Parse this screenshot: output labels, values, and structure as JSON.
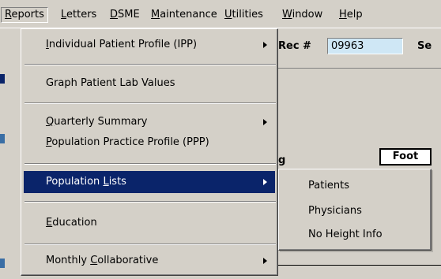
{
  "menubar": {
    "items": [
      {
        "label": "Reports",
        "active": true
      },
      {
        "label": "Letters"
      },
      {
        "label": "DSME"
      },
      {
        "label": "Maintenance"
      },
      {
        "label": "Utilities"
      },
      {
        "label": "Window"
      },
      {
        "label": "Help"
      }
    ]
  },
  "background": {
    "rec_label": "Rec #",
    "rec_value": "09963",
    "se_label": "Se",
    "foot_label": "Foot",
    "g_fragment": "g"
  },
  "reports_menu": {
    "items": [
      {
        "label_pre": "",
        "label_u": "I",
        "label_post": "ndividual Patient Profile (IPP)",
        "submenu": true
      },
      {
        "label_pre": "Graph Patient Lab Values",
        "label_u": "",
        "label_post": "",
        "submenu": false
      },
      {
        "label_pre": "",
        "label_u": "Q",
        "label_post": "uarterly Summary",
        "submenu": true
      },
      {
        "label_pre": "",
        "label_u": "P",
        "label_post": "opulation Practice Profile (PPP)",
        "submenu": false
      },
      {
        "label_pre": "Population ",
        "label_u": "L",
        "label_post": "ists",
        "submenu": true,
        "selected": true
      },
      {
        "label_pre": "",
        "label_u": "E",
        "label_post": "ducation",
        "submenu": false
      },
      {
        "label_pre": "Monthly ",
        "label_u": "C",
        "label_post": "ollaborative",
        "submenu": true
      }
    ]
  },
  "population_lists_submenu": {
    "items": [
      {
        "label": "Patients"
      },
      {
        "label": "Physicians"
      },
      {
        "label": "No Height Info"
      }
    ]
  },
  "colors": {
    "menu_bg": "#d4d0c8",
    "highlight": "#0a246a",
    "field_bg": "#cfe7f5"
  }
}
